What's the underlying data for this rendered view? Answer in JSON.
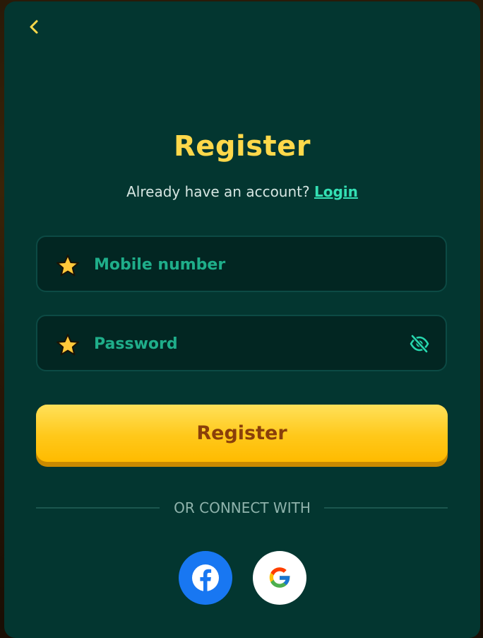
{
  "modal": {
    "title": "Register",
    "subtitle_prefix": "Already have an account?",
    "login_link": "Login"
  },
  "form": {
    "mobile": {
      "placeholder": "Mobile number",
      "value": ""
    },
    "password": {
      "placeholder": "Password",
      "value": ""
    },
    "submit_label": "Register"
  },
  "social": {
    "divider_text": "OR CONNECT WITH",
    "providers": [
      "facebook",
      "google"
    ]
  },
  "icons": {
    "back": "chevron-left-icon",
    "required": "star-icon",
    "visibility": "eye-off-icon"
  },
  "colors": {
    "panel": "#033630",
    "accent_yellow": "#ffd84a",
    "link": "#34e0b4",
    "placeholder": "#1fae8a",
    "button_text": "#8a3f0a",
    "facebook": "#1877f2"
  }
}
